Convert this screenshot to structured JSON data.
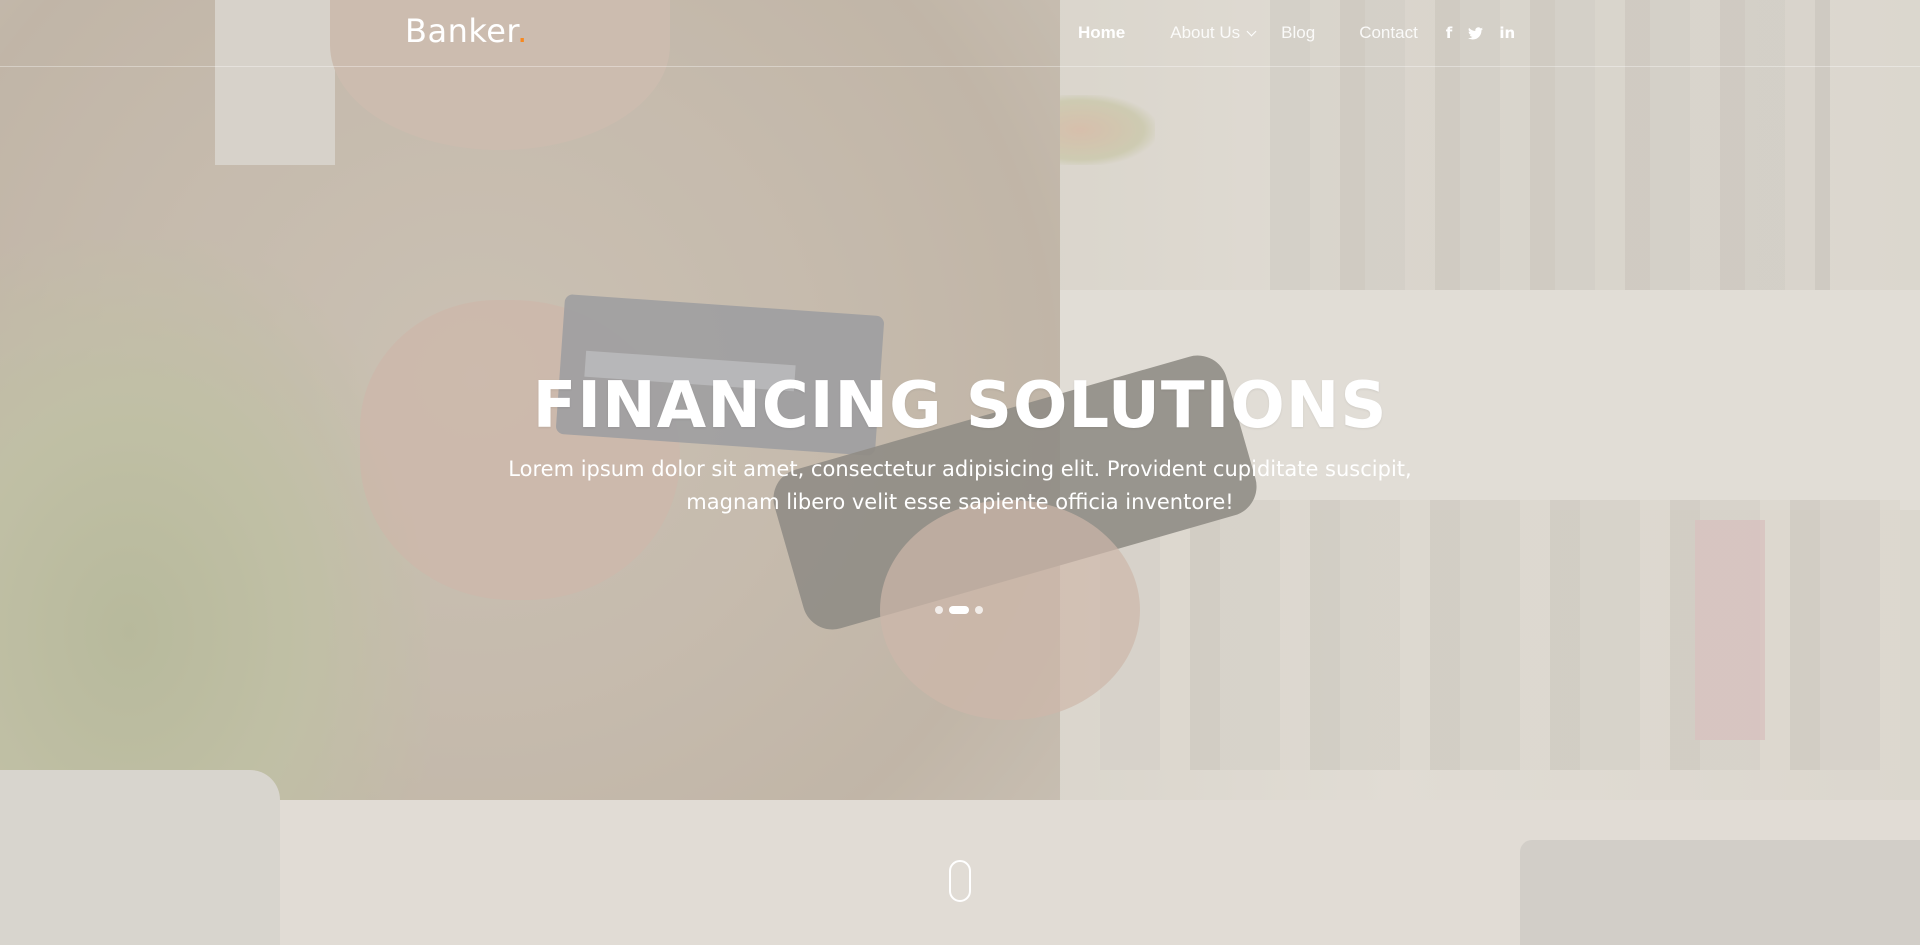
{
  "brand": {
    "name": "Banker",
    "dot": ".",
    "accent_color": "#f7881f"
  },
  "nav": {
    "items": [
      {
        "label": "Home",
        "active": true
      },
      {
        "label": "About Us",
        "has_dropdown": true
      },
      {
        "label": "Blog"
      },
      {
        "label": "Contact"
      }
    ],
    "social": [
      {
        "icon": "facebook-icon",
        "glyph": "f"
      },
      {
        "icon": "twitter-icon"
      },
      {
        "icon": "linkedin-icon",
        "glyph": "in"
      }
    ]
  },
  "hero": {
    "title": "FINANCING SOLUTIONS",
    "text": "Lorem ipsum dolor sit amet, consectetur adipisicing elit. Provident cupiditate suscipit, magnam libero velit esse sapiente officia inventore!",
    "slides": {
      "count": 3,
      "active_index": 1
    }
  },
  "scroll_indicator": {
    "icon": "mouse-scroll-icon"
  }
}
